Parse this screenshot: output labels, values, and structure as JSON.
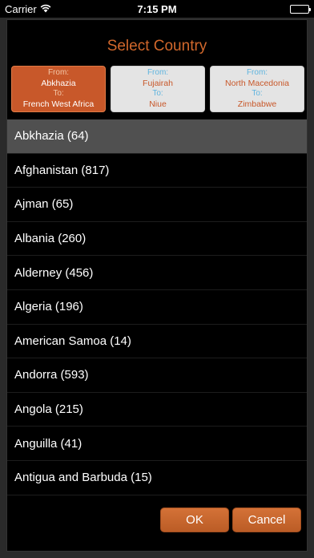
{
  "status_bar": {
    "carrier": "Carrier",
    "time": "7:15 PM",
    "battery_level": 1.0
  },
  "dialog": {
    "title": "Select Country",
    "ranges": [
      {
        "from_label": "From:",
        "from": "Abkhazia",
        "to_label": "To:",
        "to": "French West Africa",
        "active": true
      },
      {
        "from_label": "From:",
        "from": "Fujairah",
        "to_label": "To:",
        "to": "Niue",
        "active": false
      },
      {
        "from_label": "From:",
        "from": "North Macedonia",
        "to_label": "To:",
        "to": "Zimbabwe",
        "active": false
      }
    ],
    "countries": [
      "Abkhazia (64)",
      "Afghanistan (817)",
      "Ajman (65)",
      "Albania (260)",
      "Alderney (456)",
      "Algeria (196)",
      "American Samoa (14)",
      "Andorra (593)",
      "Angola (215)",
      "Anguilla (41)",
      "Antigua and Barbuda (15)"
    ],
    "selected_index": 0,
    "ok_label": "OK",
    "cancel_label": "Cancel"
  },
  "colors": {
    "accent": "#d2682c",
    "selected_row": "#505050",
    "to_from_label": "#5eb4df"
  }
}
